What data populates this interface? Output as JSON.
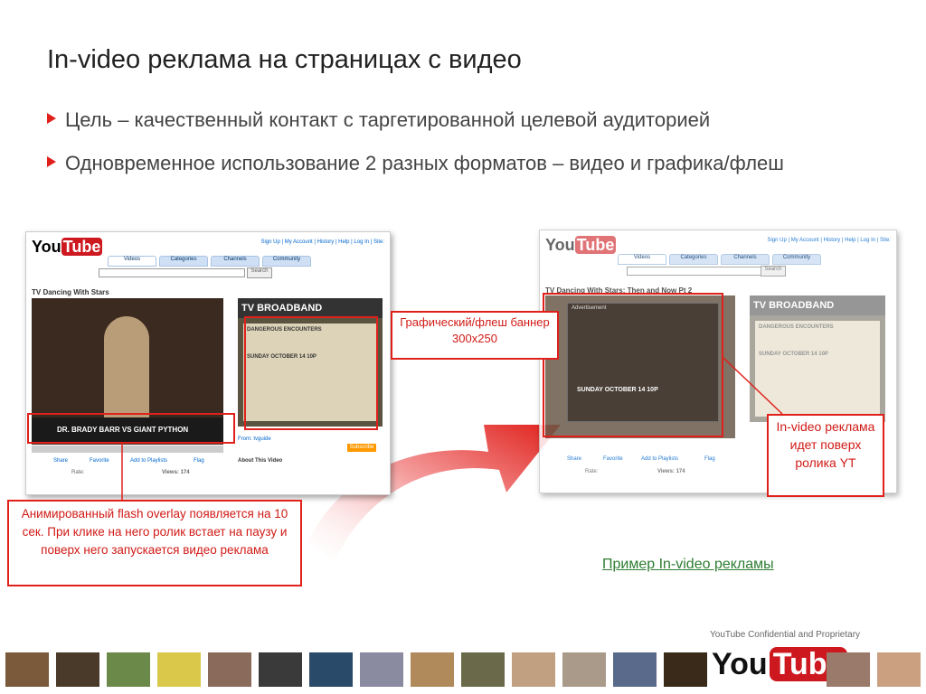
{
  "slide": {
    "title": "In-video реклама на страницах с видео",
    "bullets": [
      "Цель – качественный контакт с таргетированной целевой аудиторией",
      "Одновременное использование 2 разных форматов – видео и графика/флеш"
    ]
  },
  "screenshot1": {
    "logo_you": "You",
    "logo_tube": "Tube",
    "toplinks": "Sign Up | My Account | History | Help | Log In | Site:",
    "tabs": [
      "Videos",
      "Categories",
      "Channels",
      "Community"
    ],
    "search_label": "Search",
    "video_title": "TV Dancing With Stars",
    "overlay_text": "DR. BRADY BARR VS GIANT PYTHON",
    "ad_header": "TV BROADBAND",
    "ad_text": "DANGEROUS ENCOUNTERS",
    "ad_date": "SUNDAY OCTOBER 14 10P",
    "share": "Share",
    "favorite": "Favorite",
    "playlists": "Add to Playlists",
    "flag": "Flag",
    "rate": "Rate:",
    "views": "Views: 174",
    "from": "From: tvguide",
    "subscribe": "Subscribe",
    "about": "About This Video"
  },
  "screenshot2": {
    "logo_you": "You",
    "logo_tube": "Tube",
    "toplinks": "Sign Up | My Account | History | Help | Log In | Site:",
    "tabs": [
      "Videos",
      "Categories",
      "Channels",
      "Community"
    ],
    "search_label": "Search",
    "video_title": "TV Dancing With Stars: Then and Now Pt 2",
    "overlay_label": "Advertisement",
    "overlay_date": "SUNDAY OCTOBER 14 10P",
    "ad_header": "TV BROADBAND",
    "ad_text": "DANGEROUS ENCOUNTERS",
    "ad_date": "SUNDAY OCTOBER 14 10P",
    "share": "Share",
    "favorite": "Favorite",
    "playlists": "Add to Playlists",
    "flag": "Flag",
    "rate": "Rate:",
    "views": "Views: 174"
  },
  "callouts": {
    "banner": "Графический/флеш баннер 300x250",
    "overlay": "Анимированный flash overlay появляется на 10 сек. При клике на него ролик встает на паузу и поверх него запускается видео реклама",
    "invideo": "In-video реклама идет поверх ролика YT"
  },
  "link_text": "Пример In-video рекламы",
  "footer": {
    "confidential": "YouTube Confidential and Proprietary",
    "logo_you": "You",
    "logo_tube": "Tube"
  },
  "colors": {
    "accent": "#e0201b",
    "link": "#2e7d32",
    "youtube_red": "#cc181e"
  }
}
